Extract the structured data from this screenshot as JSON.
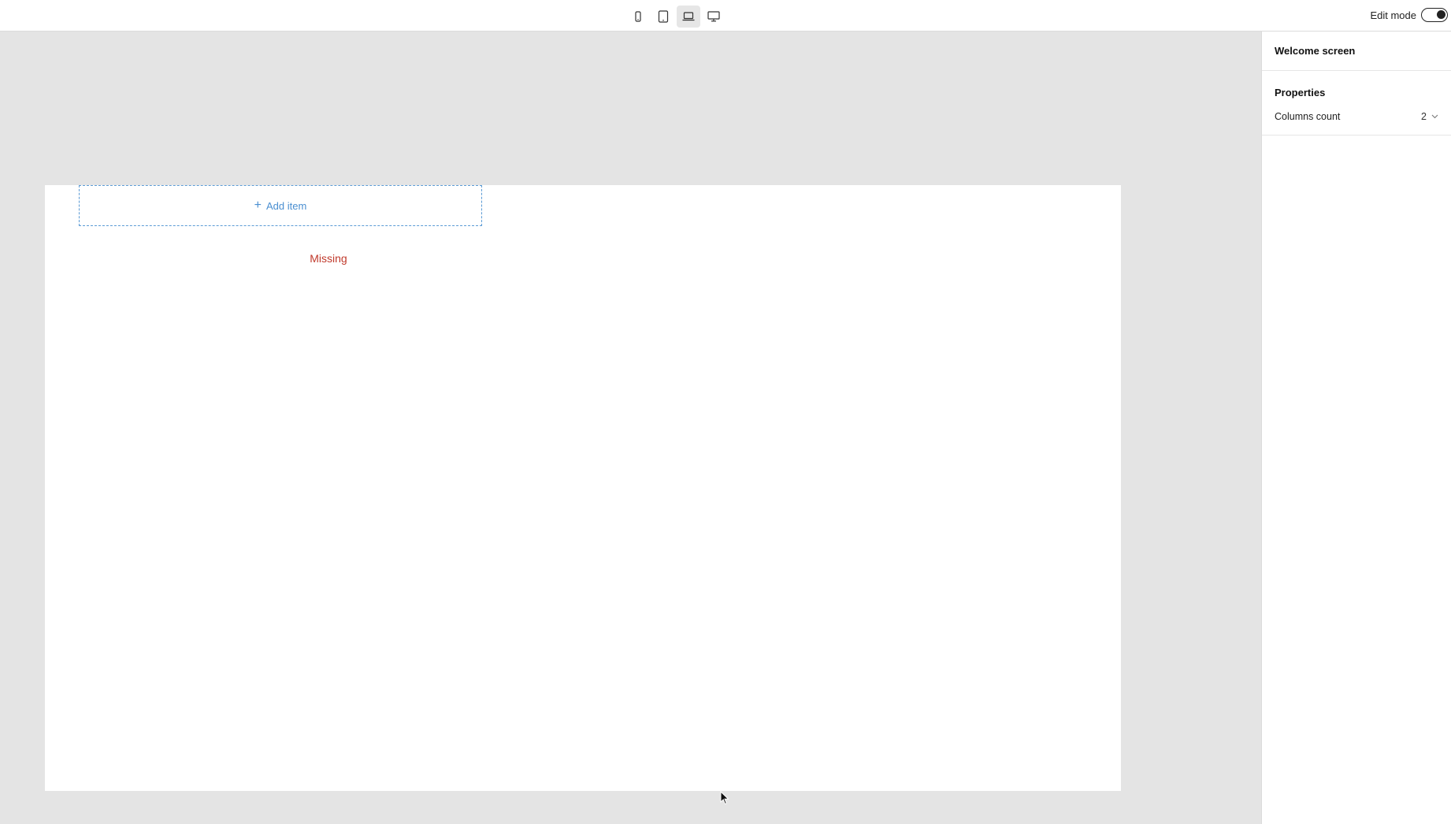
{
  "toolbar": {
    "devices": [
      {
        "name": "mobile",
        "icon": "mobile-icon"
      },
      {
        "name": "tablet",
        "icon": "tablet-icon"
      },
      {
        "name": "laptop",
        "icon": "laptop-icon",
        "active": true
      },
      {
        "name": "desktop",
        "icon": "desktop-icon"
      }
    ],
    "edit_mode_label": "Edit mode",
    "edit_mode_on": true
  },
  "canvas": {
    "add_item_label": "Add item",
    "missing_label": "Missing"
  },
  "panel": {
    "title": "Welcome screen",
    "properties_title": "Properties",
    "columns_count_label": "Columns count",
    "columns_count_value": "2"
  },
  "colors": {
    "accent": "#4a8fd1",
    "error": "#c0392b",
    "canvas_bg": "#e4e4e4"
  }
}
